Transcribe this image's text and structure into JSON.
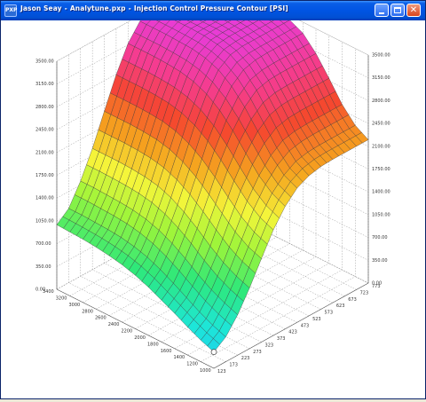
{
  "window": {
    "title_parts": [
      "Jason Seay",
      "Analytune.pxp",
      "Injection Control Pressure Contour [PSI]"
    ],
    "separator": "-",
    "icon": "pxp-app-icon",
    "app_icon_text": "PXP",
    "controls": {
      "minimize": "minimize-icon",
      "maximize": "maximize-icon",
      "close": "close-icon",
      "close_glyph": "✕"
    }
  },
  "chart_data": {
    "type": "surface",
    "title": "Injection Control Pressure Contour [PSI]",
    "z_axis": {
      "ticks": [
        "0.00",
        "350.00",
        "700.00",
        "1050.00",
        "1400.00",
        "1750.00",
        "2100.00",
        "2450.00",
        "2800.00",
        "3150.00",
        "3500.00"
      ],
      "range": [
        0,
        3500
      ]
    },
    "rpm_axis": {
      "ticks": [
        "1000",
        "1200",
        "1400",
        "1600",
        "1800",
        "2000",
        "2200",
        "2400",
        "2600",
        "2800",
        "3000",
        "3200",
        "3400"
      ],
      "range": [
        1000,
        3400
      ]
    },
    "load_axis": {
      "ticks": [
        "123",
        "173",
        "223",
        "273",
        "323",
        "373",
        "423",
        "473",
        "523",
        "573",
        "623",
        "673",
        "723",
        "773"
      ],
      "range": [
        123,
        773
      ]
    },
    "surface_rows_by_rpm": [
      [
        250,
        380,
        620,
        930,
        1280,
        1620,
        1880,
        2060,
        2150,
        2190,
        2200,
        2200,
        2200,
        2200
      ],
      [
        330,
        460,
        700,
        1010,
        1360,
        1710,
        1980,
        2160,
        2270,
        2310,
        2320,
        2320,
        2320,
        2320
      ],
      [
        430,
        560,
        800,
        1120,
        1490,
        1860,
        2150,
        2360,
        2490,
        2530,
        2540,
        2540,
        2540,
        2540
      ],
      [
        540,
        680,
        930,
        1270,
        1670,
        2070,
        2390,
        2630,
        2780,
        2830,
        2840,
        2840,
        2840,
        2840
      ],
      [
        640,
        800,
        1080,
        1440,
        1860,
        2290,
        2640,
        2900,
        3060,
        3110,
        3120,
        3120,
        3120,
        3120
      ],
      [
        740,
        910,
        1210,
        1590,
        2030,
        2480,
        2850,
        3120,
        3270,
        3320,
        3330,
        3330,
        3330,
        3330
      ],
      [
        820,
        1000,
        1310,
        1710,
        2160,
        2620,
        3000,
        3270,
        3400,
        3430,
        3430,
        3430,
        3430,
        3430
      ],
      [
        880,
        1060,
        1380,
        1790,
        2250,
        2710,
        3090,
        3350,
        3460,
        3480,
        3480,
        3480,
        3480,
        3480
      ],
      [
        920,
        1100,
        1420,
        1830,
        2300,
        2760,
        3140,
        3390,
        3490,
        3500,
        3500,
        3500,
        3500,
        3500
      ],
      [
        950,
        1120,
        1440,
        1850,
        2320,
        2780,
        3160,
        3400,
        3500,
        3500,
        3500,
        3500,
        3500,
        3500
      ],
      [
        970,
        1130,
        1450,
        1860,
        2330,
        2790,
        3170,
        3410,
        3500,
        3500,
        3500,
        3500,
        3500,
        3500
      ],
      [
        980,
        1140,
        1460,
        1860,
        2330,
        2790,
        3170,
        3410,
        3500,
        3500,
        3500,
        3500,
        3500,
        3500
      ],
      [
        990,
        1140,
        1460,
        1860,
        2330,
        2790,
        3170,
        3410,
        3500,
        3500,
        3500,
        3500,
        3500,
        3500
      ]
    ],
    "colormap": [
      "#1ebff5",
      "#1de6d9",
      "#2ee87a",
      "#9bf53a",
      "#f5f53a",
      "#f5a21e",
      "#f5462f",
      "#f53c8e",
      "#e83cd6"
    ],
    "grid": true,
    "projection": "3d-oblique"
  }
}
